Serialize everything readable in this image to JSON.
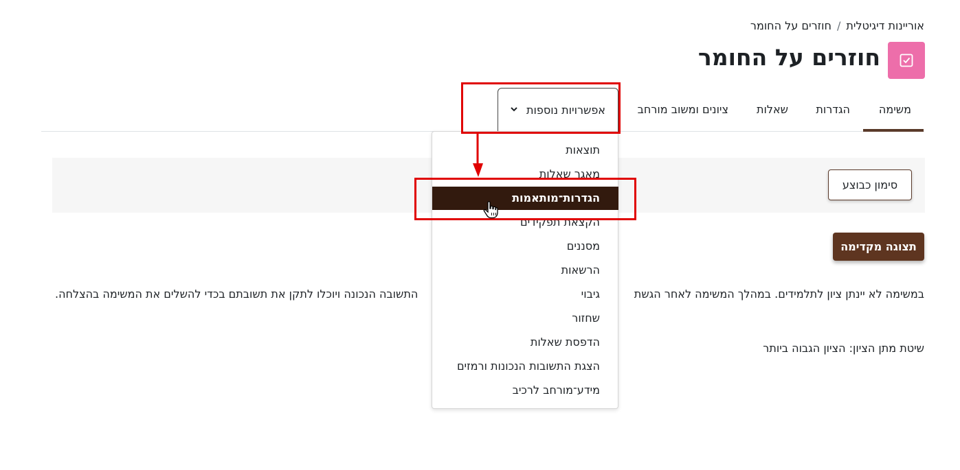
{
  "breadcrumb": {
    "course": "אוריינות דיגיטלית",
    "separator": "/",
    "current": "חוזרים על החומר"
  },
  "header": {
    "title": "חוזרים על החומר",
    "icon": "assignment-check-icon",
    "icon_color": "#ed6eaa"
  },
  "tabs": [
    {
      "label": "משימה",
      "active": true
    },
    {
      "label": "הגדרות"
    },
    {
      "label": "שאלות"
    },
    {
      "label": "ציונים ומשוב מורחב"
    },
    {
      "label": "אפשרויות נוספות",
      "open": true
    }
  ],
  "main": {
    "done_button": "סימון כבוצע",
    "preview_button": "תצוגה מקדימה",
    "description_right": "במשימה לא יינתן ציון לתלמידים. במהלך המשימה לאחר הגשת",
    "description_left": "התשובה הנכונה ויוכלו לתקן את תשובתם בכדי להשלים את המשימה בהצלחה.",
    "grading_method": "שיטת מתן הציון: הציון הגבוה ביותר"
  },
  "dropdown": {
    "items": [
      "תוצאות",
      "מאגר שאלות",
      "הגדרות־מותאמות",
      "הקצאת תפקידים",
      "מסננים",
      "הרשאות",
      "גיבוי",
      "שחזור",
      "הדפסת שאלות",
      "הצגת התשובות הנכונות ורמזים",
      "מידע־מורחב לרכיב"
    ],
    "highlighted_index": 2
  },
  "colors": {
    "accent": "#5e3520",
    "highlight": "#321a0e",
    "annotation": "#e00000"
  }
}
